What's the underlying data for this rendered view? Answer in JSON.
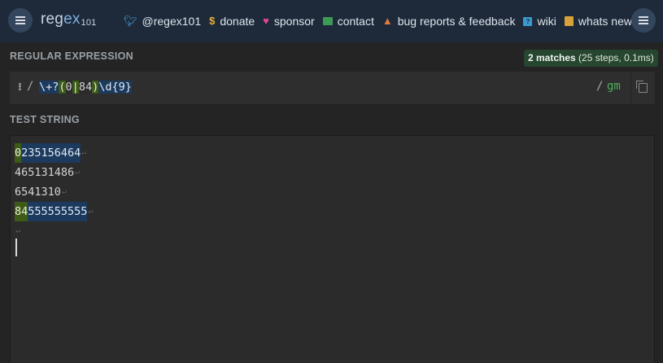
{
  "header": {
    "logo_prefix": "reg",
    "logo_accent": "ex",
    "logo_suffix": "101",
    "nav": [
      {
        "icon": "twitter-icon",
        "label": "@regex101"
      },
      {
        "icon": "dollar-icon",
        "label": "donate"
      },
      {
        "icon": "heart-icon",
        "label": "sponsor"
      },
      {
        "icon": "mail-icon",
        "label": "contact"
      },
      {
        "icon": "warning-icon",
        "label": "bug reports & feedback"
      },
      {
        "icon": "wiki-icon",
        "label": "wiki"
      },
      {
        "icon": "news-icon",
        "label": "whats new?"
      }
    ]
  },
  "regex": {
    "section_label": "REGULAR EXPRESSION",
    "match_count": "2 matches",
    "match_stats": " (25 steps, 0.1ms)",
    "drag_handle": "⁝",
    "open_delimiter": "/",
    "pattern_tokens": [
      {
        "text": "\\+",
        "kind": "esc"
      },
      {
        "text": "?",
        "kind": "quant"
      },
      {
        "text": "(",
        "kind": "group"
      },
      {
        "text": "0",
        "kind": "lit"
      },
      {
        "text": "|",
        "kind": "alt"
      },
      {
        "text": "84",
        "kind": "lit"
      },
      {
        "text": ")",
        "kind": "group"
      },
      {
        "text": "\\d",
        "kind": "class"
      },
      {
        "text": "{9}",
        "kind": "quant"
      }
    ],
    "close_delimiter": "/",
    "flags": "gm"
  },
  "test": {
    "section_label": "TEST STRING",
    "lines": [
      {
        "group": "0",
        "rest": "235156464",
        "matched": true
      },
      {
        "group": "",
        "rest": "465131486",
        "matched": false
      },
      {
        "group": "",
        "rest": "6541310",
        "matched": false
      },
      {
        "group": "84",
        "rest": "555555555",
        "matched": true
      },
      {
        "group": "",
        "rest": "",
        "matched": false
      }
    ],
    "newline_glyph": "↵"
  },
  "colors": {
    "header_bg": "#1e2a3a",
    "group_highlight": "#3d5a17",
    "match_highlight": "#1c3a5e",
    "flags": "#4eb05a",
    "match_badge": "#27462f"
  }
}
